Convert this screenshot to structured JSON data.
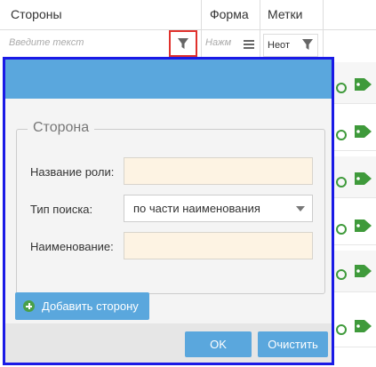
{
  "columns": {
    "parties": "Стороны",
    "form": "Форма",
    "tags": "Метки"
  },
  "filters": {
    "parties_placeholder": "Введите текст",
    "form_placeholder": "Нажм",
    "tags_value": "Неот"
  },
  "popup": {
    "section_title": "Сторона",
    "role_label": "Название роли:",
    "role_value": "",
    "search_type_label": "Тип поиска:",
    "search_type_value": "по части наименования",
    "name_label": "Наименование:",
    "name_value": "",
    "add_button": "Добавить сторону",
    "ok_button": "OK",
    "clear_button": "Очистить"
  },
  "colors": {
    "accent": "#5aa7dd",
    "highlight_red": "#e0312c",
    "popup_border": "#1a1ae6",
    "tag_green": "#3f9a3b",
    "input_bg": "#fdf3e3"
  }
}
